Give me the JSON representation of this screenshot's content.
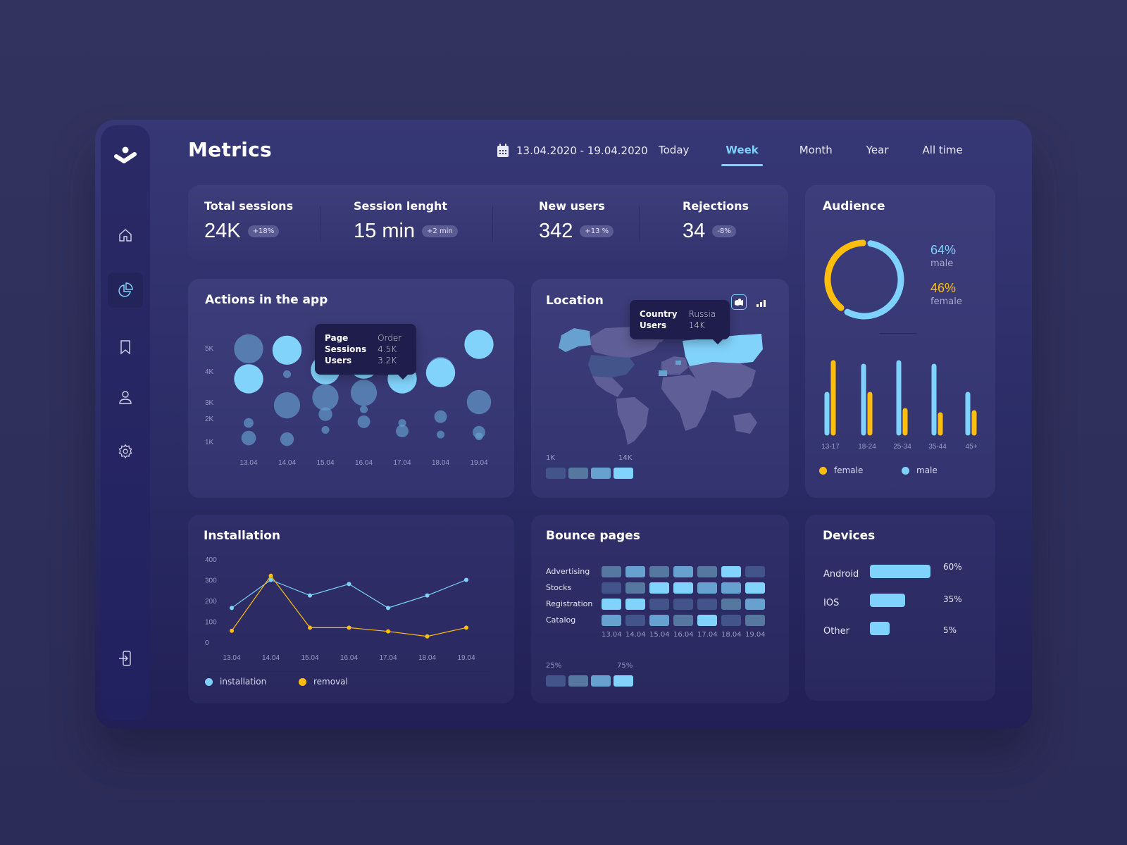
{
  "app": {
    "title": "Metrics"
  },
  "header": {
    "date_icon": "calendar-icon",
    "date_range": "13.04.2020 - 19.04.2020",
    "tabs": [
      {
        "label": "Today",
        "active": false
      },
      {
        "label": "Week",
        "active": true
      },
      {
        "label": "Month",
        "active": false
      },
      {
        "label": "Year",
        "active": false
      },
      {
        "label": "All time",
        "active": false
      }
    ]
  },
  "sidebar": {
    "logo": "logo-icon",
    "items": [
      {
        "name": "home",
        "icon": "home-icon",
        "active": false
      },
      {
        "name": "analytics",
        "icon": "pie-chart-icon",
        "active": true
      },
      {
        "name": "bookmarks",
        "icon": "bookmark-icon",
        "active": false
      },
      {
        "name": "profile",
        "icon": "user-icon",
        "active": false
      },
      {
        "name": "settings",
        "icon": "gear-icon",
        "active": false
      }
    ],
    "logout_icon": "logout-icon"
  },
  "stats": [
    {
      "label": "Total sessions",
      "value": "24K",
      "delta": "+18%"
    },
    {
      "label": "Session lenght",
      "value": "15 min",
      "delta": "+2 min"
    },
    {
      "label": "New users",
      "value": "342",
      "delta": "+13 %"
    },
    {
      "label": "Rejections",
      "value": "34",
      "delta": "-8%"
    }
  ],
  "colors": {
    "accent": "#7fd2fb",
    "female": "#ffbe0b",
    "male": "#7fd2fb",
    "scale": [
      "#43548a",
      "#56779f",
      "#67a1cf",
      "#82d3fc"
    ]
  },
  "chart_data": [
    {
      "id": "actions",
      "type": "scatter",
      "title": "Actions in the app",
      "x": [
        "13.04",
        "14.04",
        "15.04",
        "16.04",
        "17.04",
        "18.04",
        "19.04"
      ],
      "yticks": [
        "5K",
        "4K",
        "3K",
        "2K",
        "1K"
      ],
      "tooltip": {
        "rows": [
          [
            "Page",
            "Order"
          ],
          [
            "Sessions",
            "4.5K"
          ],
          [
            "Users",
            "3.2K"
          ]
        ]
      },
      "bubbles": [
        {
          "x": 0,
          "y": 4.96,
          "size": 3,
          "level": 2
        },
        {
          "x": 0,
          "y": 3.75,
          "size": 3,
          "level": 4
        },
        {
          "x": 0,
          "y": 1.8,
          "size": 1,
          "level": 2
        },
        {
          "x": 0,
          "y": 1.15,
          "size": 1.5,
          "level": 2
        },
        {
          "x": 1,
          "y": 4.9,
          "size": 3,
          "level": 4
        },
        {
          "x": 1,
          "y": 3.9,
          "size": 0.8,
          "level": 2
        },
        {
          "x": 1,
          "y": 2.8,
          "size": 2.7,
          "level": 2
        },
        {
          "x": 1,
          "y": 1.1,
          "size": 1.4,
          "level": 2
        },
        {
          "x": 2,
          "y": 4.05,
          "size": 3,
          "level": 4
        },
        {
          "x": 2,
          "y": 3.15,
          "size": 2.7,
          "level": 2
        },
        {
          "x": 2,
          "y": 2.25,
          "size": 1.4,
          "level": 2
        },
        {
          "x": 2,
          "y": 1.5,
          "size": 0.8,
          "level": 2
        },
        {
          "x": 3,
          "y": 4.3,
          "size": 3,
          "level": 4
        },
        {
          "x": 3,
          "y": 3.3,
          "size": 2.7,
          "level": 2
        },
        {
          "x": 3,
          "y": 2.55,
          "size": 0.8,
          "level": 2
        },
        {
          "x": 3,
          "y": 1.85,
          "size": 1.3,
          "level": 2
        },
        {
          "x": 4,
          "y": 3.75,
          "size": 3,
          "level": 4
        },
        {
          "x": 4,
          "y": 1.8,
          "size": 0.8,
          "level": 2
        },
        {
          "x": 4,
          "y": 1.45,
          "size": 1.3,
          "level": 2
        },
        {
          "x": 5,
          "y": 4.05,
          "size": 2.7,
          "level": 2
        },
        {
          "x": 5,
          "y": 3.95,
          "size": 3,
          "level": 4
        },
        {
          "x": 5,
          "y": 2.1,
          "size": 1.3,
          "level": 2
        },
        {
          "x": 5,
          "y": 1.3,
          "size": 0.8,
          "level": 2
        },
        {
          "x": 6,
          "y": 5.15,
          "size": 3,
          "level": 4
        },
        {
          "x": 6,
          "y": 3.0,
          "size": 2.5,
          "level": 2
        },
        {
          "x": 6,
          "y": 1.4,
          "size": 1.3,
          "level": 2
        },
        {
          "x": 6,
          "y": 1.22,
          "size": 0.8,
          "level": 2
        }
      ]
    },
    {
      "id": "audience-donut",
      "type": "pie",
      "title": "Audience",
      "slices": [
        {
          "label": "male",
          "value": 64,
          "text": "64%"
        },
        {
          "label": "female",
          "value": 46,
          "text": "46%"
        }
      ]
    },
    {
      "id": "audience-age",
      "type": "bar",
      "categories": [
        "13-17",
        "18-24",
        "25-34",
        "35-44",
        "45+"
      ],
      "series": [
        {
          "name": "male",
          "values": [
            55,
            95,
            100,
            95,
            55
          ]
        },
        {
          "name": "female",
          "values": [
            100,
            55,
            32,
            26,
            29
          ]
        }
      ],
      "legend": [
        "female",
        "male"
      ]
    },
    {
      "id": "installation",
      "type": "line",
      "title": "Installation",
      "x": [
        "13.04",
        "14.04",
        "15.04",
        "16.04",
        "17.04",
        "18.04",
        "19.04"
      ],
      "yticks": [
        "400",
        "300",
        "200",
        "100",
        "0"
      ],
      "ylim": [
        0,
        400
      ],
      "series": [
        {
          "name": "installation",
          "values": [
            165,
            300,
            225,
            280,
            165,
            225,
            300
          ]
        },
        {
          "name": "removal",
          "values": [
            55,
            320,
            70,
            70,
            52,
            28,
            70
          ]
        }
      ]
    },
    {
      "id": "bounce",
      "type": "heatmap",
      "title": "Bounce pages",
      "rows": [
        "Advertising",
        "Stocks",
        "Registration",
        "Catalog"
      ],
      "columns": [
        "13.04",
        "14.04",
        "15.04",
        "16.04",
        "17.04",
        "18.04",
        "19.04"
      ],
      "levels": [
        [
          2,
          3,
          2,
          3,
          2,
          4,
          1
        ],
        [
          1,
          2,
          4,
          4,
          3,
          3,
          4
        ],
        [
          4,
          4,
          1,
          1,
          1,
          2,
          3
        ],
        [
          3,
          1,
          3,
          2,
          4,
          1,
          2
        ]
      ],
      "scale_min": "25%",
      "scale_max": "75%"
    },
    {
      "id": "devices",
      "type": "bar",
      "title": "Devices",
      "categories": [
        "Android",
        "IOS",
        "Other"
      ],
      "values": [
        60,
        35,
        5
      ],
      "labels": [
        "60%",
        "35%",
        "5%"
      ]
    }
  ],
  "location": {
    "title": "Location",
    "tooltip": {
      "rows": [
        [
          "Country",
          "Russia"
        ],
        [
          "Users",
          "14K"
        ]
      ]
    },
    "scale_min": "1K",
    "scale_max": "14K",
    "map_view_icon": "map-icon",
    "bars_view_icon": "signal-bars-icon"
  }
}
